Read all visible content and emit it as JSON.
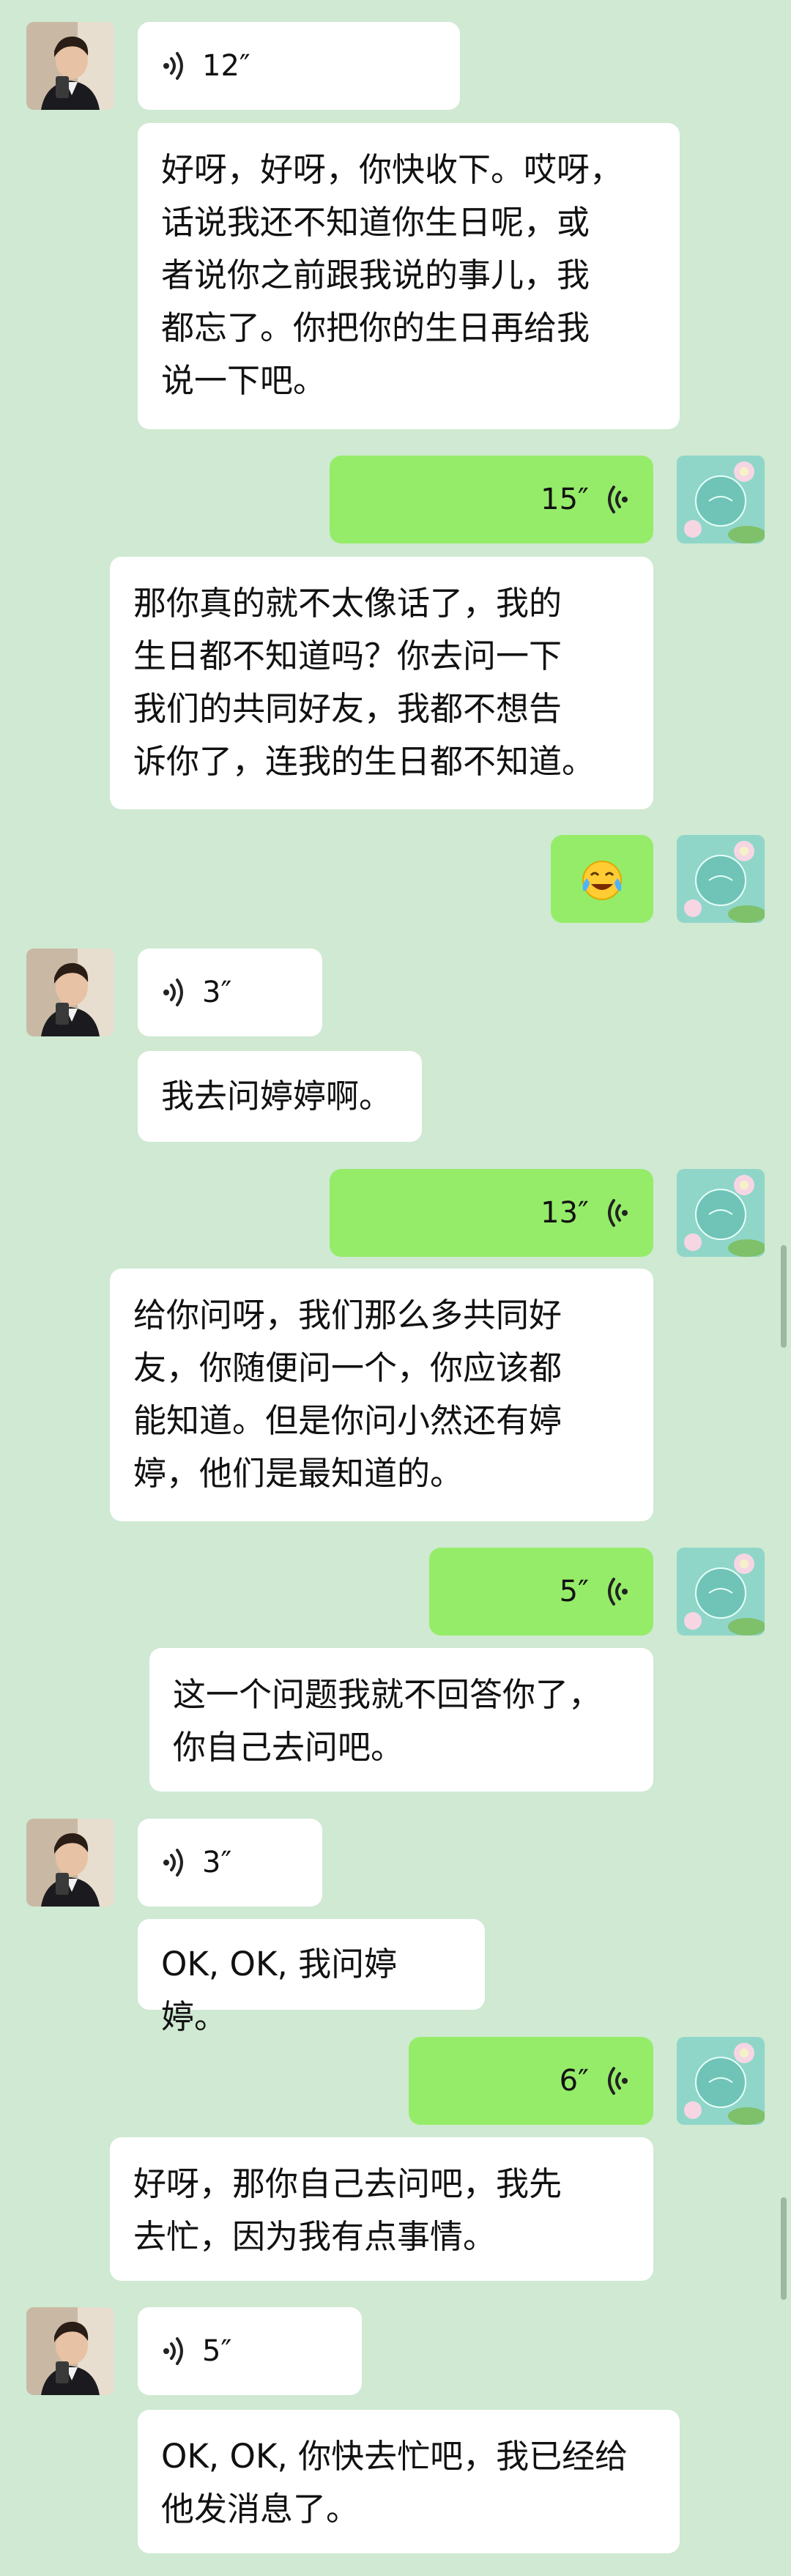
{
  "colors": {
    "background": "#cfe9d2",
    "received_bubble": "#ffffff",
    "sent_bubble": "#95ec69"
  },
  "messages": [
    {
      "side": "left",
      "type": "voice",
      "duration": "12″"
    },
    {
      "side": "left",
      "type": "text",
      "text": "好呀，好呀，你快收下。哎呀，\n话说我还不知道你生日呢，或\n者说你之前跟我说的事儿，我\n都忘了。你把你的生日再给我\n说一下吧。"
    },
    {
      "side": "right",
      "type": "voice",
      "duration": "15″"
    },
    {
      "side": "right",
      "type": "text",
      "text": "那你真的就不太像话了，我的\n生日都不知道吗？你去问一下\n我们的共同好友，我都不想告\n诉你了，连我的生日都不知道。"
    },
    {
      "side": "right",
      "type": "emoji",
      "icon": "crying-laughing-emoji"
    },
    {
      "side": "left",
      "type": "voice",
      "duration": "3″"
    },
    {
      "side": "left",
      "type": "text",
      "text": "我去问婷婷啊。"
    },
    {
      "side": "right",
      "type": "voice",
      "duration": "13″"
    },
    {
      "side": "right",
      "type": "text",
      "text": "给你问呀，我们那么多共同好\n友，你随便问一个，你应该都\n能知道。但是你问小然还有婷\n婷，他们是最知道的。"
    },
    {
      "side": "right",
      "type": "voice",
      "duration": "5″"
    },
    {
      "side": "right",
      "type": "text",
      "text": "这一个问题我就不回答你了，\n你自己去问吧。"
    },
    {
      "side": "left",
      "type": "voice",
      "duration": "3″"
    },
    {
      "side": "left",
      "type": "text",
      "text": "OK, OK, 我问婷婷。"
    },
    {
      "side": "right",
      "type": "voice",
      "duration": "6″"
    },
    {
      "side": "right",
      "type": "text",
      "text": "好呀，那你自己去问吧，我先\n去忙，因为我有点事情。"
    },
    {
      "side": "left",
      "type": "voice",
      "duration": "5″"
    },
    {
      "side": "left",
      "type": "text",
      "text": "OK, OK, 你快去忙吧，我已经给\n他发消息了。"
    }
  ]
}
